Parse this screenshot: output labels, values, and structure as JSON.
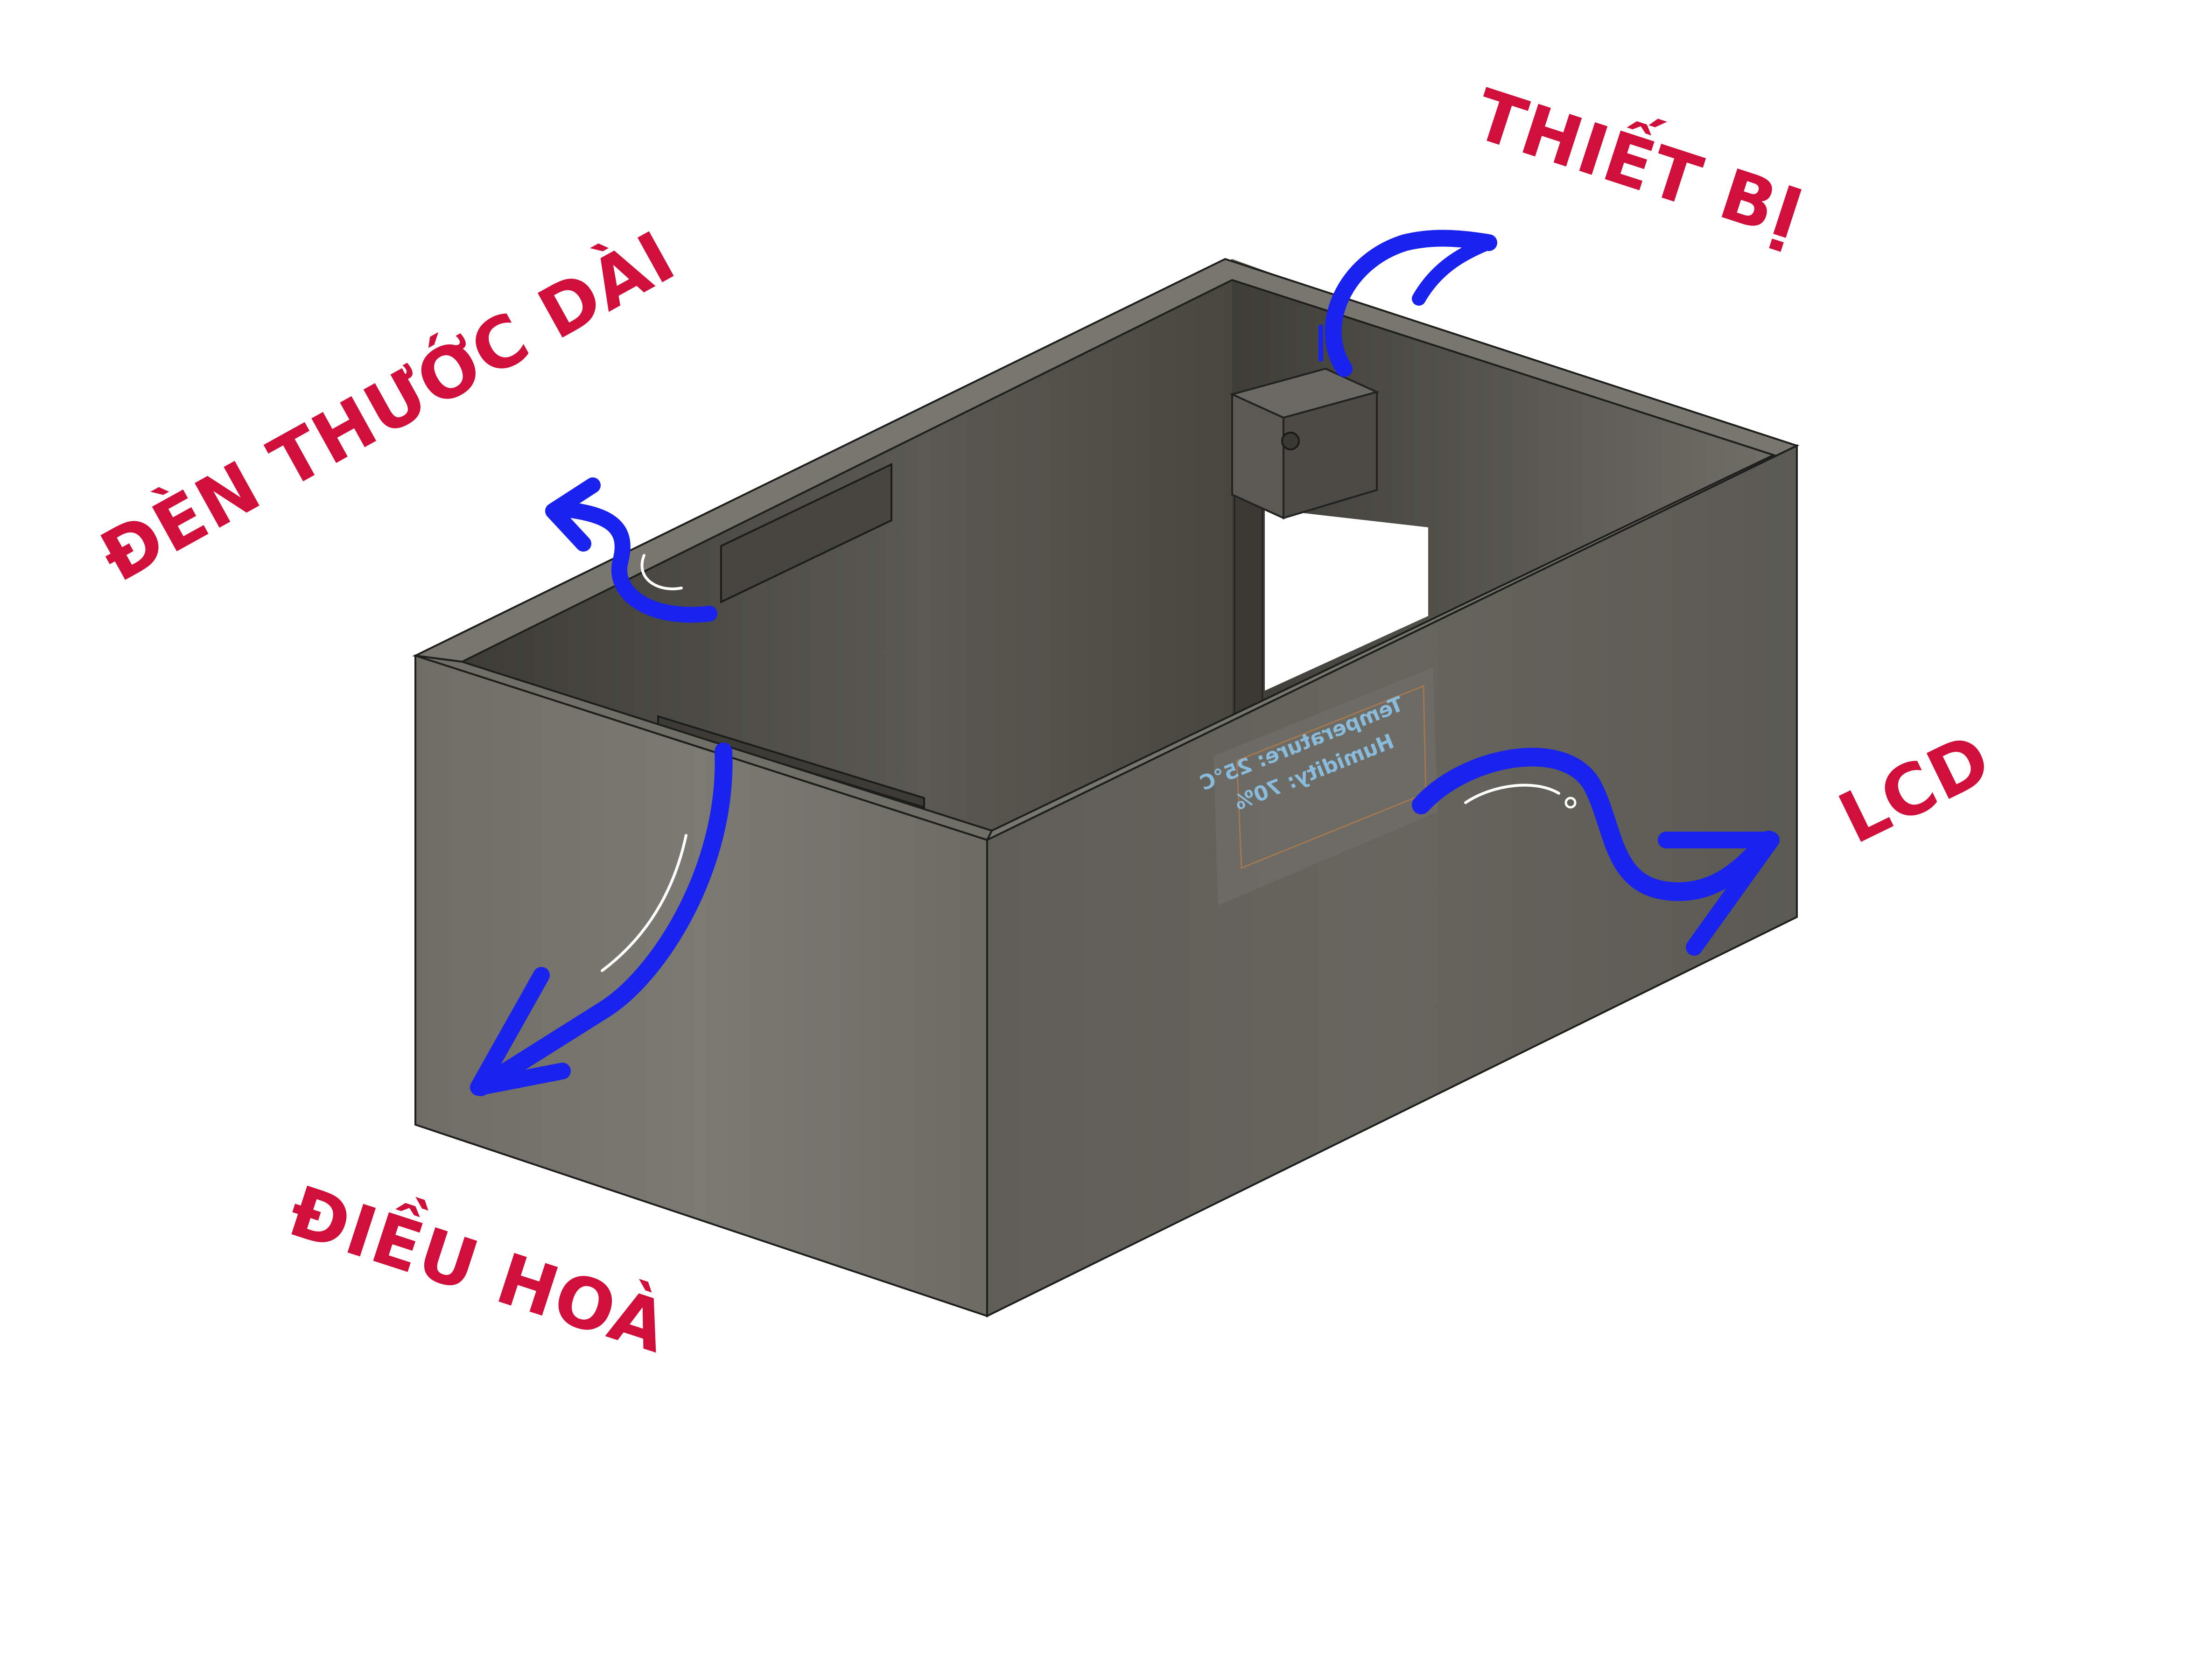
{
  "labels": {
    "ceiling_light": "ĐÈN THƯỚC DÀI",
    "device": "THIẾT BỊ",
    "lcd": "LCD",
    "air_conditioner": "ĐIỀU HOÀ"
  },
  "lcd_screen": {
    "line1": "Temperature: 25°C",
    "line2": "Humidity: 70%"
  },
  "colors": {
    "label": "#d0103a",
    "arrow": "#1a22ee",
    "box_front": "#6b6a63",
    "box_inner": "#4e4d47",
    "lcd_text": "#8fc4e8"
  },
  "icons": {
    "arrow": "curved-arrow-icon"
  }
}
